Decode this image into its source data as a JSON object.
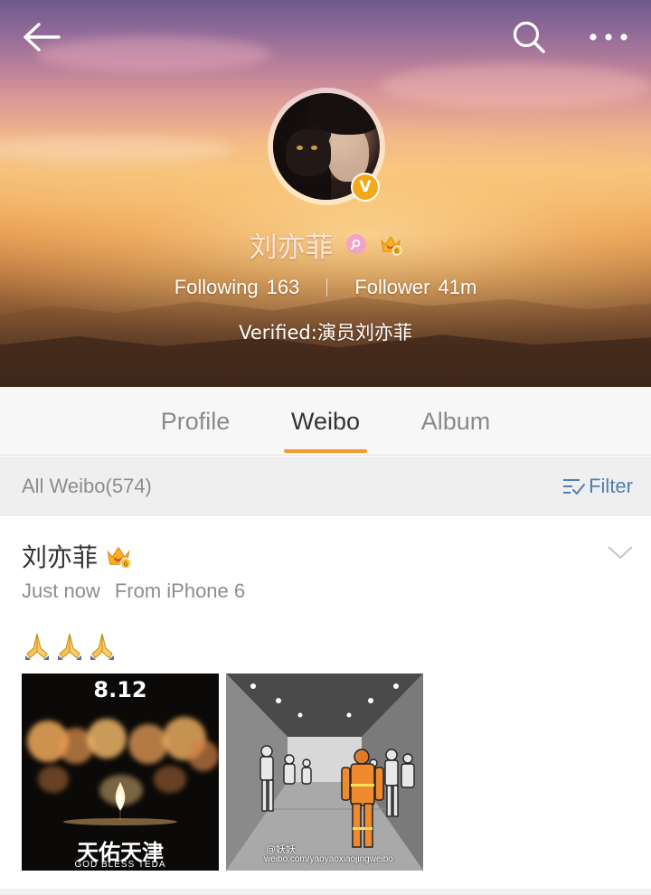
{
  "header": {
    "back": "back-icon",
    "search": "search-icon",
    "more": "more-icon",
    "avatar_badge": "V",
    "name": "刘亦菲",
    "following_label": "Following",
    "following_count": "163",
    "follower_label": "Follower",
    "follower_count": "41m",
    "verified_text": "Verified:演员刘亦菲"
  },
  "tabs": [
    {
      "label": "Profile",
      "active": false
    },
    {
      "label": "Weibo",
      "active": true
    },
    {
      "label": "Album",
      "active": false
    }
  ],
  "filter_bar": {
    "all_weibo": "All Weibo(574)",
    "filter_label": "Filter"
  },
  "post": {
    "author": "刘亦菲",
    "time": "Just now",
    "source": "From iPhone 6",
    "emoji": [
      "praying-hands",
      "praying-hands",
      "praying-hands"
    ],
    "image1": {
      "date_text": "8.12",
      "caption": "天佑天津",
      "subcaption": "GOD BLESS TEDA"
    },
    "image2": {
      "watermark": "@妖妖",
      "url": "weibo.com/yaoyaoxiaojingweibo"
    }
  },
  "colors": {
    "accent": "#f39b32",
    "filter_blue": "#4f7fb0",
    "verified_gold": "#f2a81a"
  }
}
